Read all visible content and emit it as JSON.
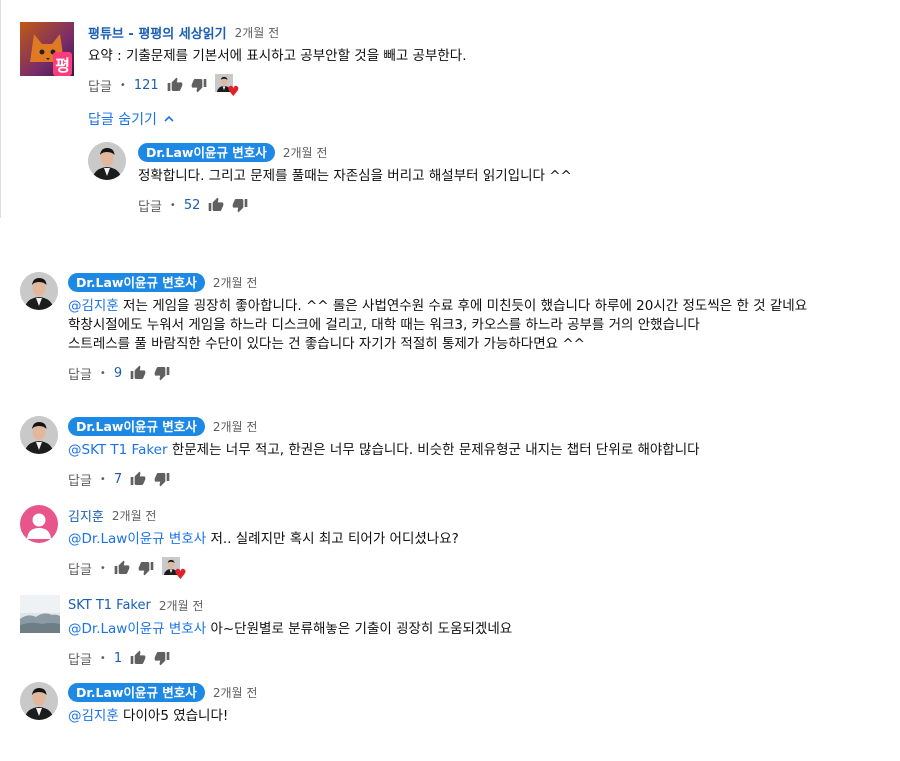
{
  "reply_label": "답글",
  "hide_replies_label": "답글 숨기기",
  "colors": {
    "link": "#1a73e8",
    "badge": "#1e88e5",
    "heart": "#e0202a"
  },
  "thread": {
    "author": "평튜브 - 평평의 세상읽기",
    "time": "2개월 전",
    "avatar_text": "평",
    "text": "요약 : 기출문제를 기본서에 표시하고 공부안할 것을 빼고 공부한다.",
    "likes": "121",
    "reply": {
      "author": "Dr.Law이윤규 변호사",
      "time": "2개월 전",
      "text": "정확합니다. 그리고 문제를 풀때는 자존심을 버리고 해설부터 읽기입니다 ^^",
      "likes": "52"
    }
  },
  "comments": [
    {
      "author": "Dr.Law이윤규 변호사",
      "time": "2개월 전",
      "mention": "@김지훈",
      "lines": [
        " 저는 게임을 굉장히 좋아합니다. ^^ 롤은 사법연수원 수료 후에 미친듯이 했습니다 하루에 20시간 정도씩은 한 것 같네요",
        "학창시절에도 누워서 게임을 하느라 디스크에 걸리고, 대학 때는 워크3, 카오스를 하느라 공부를 거의 안했습니다",
        "스트레스를 풀 바람직한 수단이 있다는 건 좋습니다 자기가 적절히 통제가 가능하다면요 ^^"
      ],
      "likes": "9"
    },
    {
      "author": "Dr.Law이윤규 변호사",
      "time": "2개월 전",
      "mention": "@SKT T1 Faker",
      "text": " 한문제는 너무 적고, 한권은 너무 많습니다. 비슷한 문제유형군 내지는 챕터 단위로 해야합니다",
      "likes": "7"
    },
    {
      "author": "김지훈",
      "time": "2개월 전",
      "mention": "@Dr.Law이윤규 변호사",
      "text": " 저.. 실례지만 혹시 최고 티어가 어디셨나요?",
      "likes": ""
    },
    {
      "author": "SKT T1 Faker",
      "time": "2개월 전",
      "mention": "@Dr.Law이윤규 변호사",
      "text": " 아~단원별로 분류해놓은 기출이 굉장히 도움되겠네요",
      "likes": "1"
    },
    {
      "author": "Dr.Law이윤규 변호사",
      "time": "2개월 전",
      "mention": "@김지훈",
      "text": " 다이아5 였습니다!",
      "likes": ""
    }
  ]
}
